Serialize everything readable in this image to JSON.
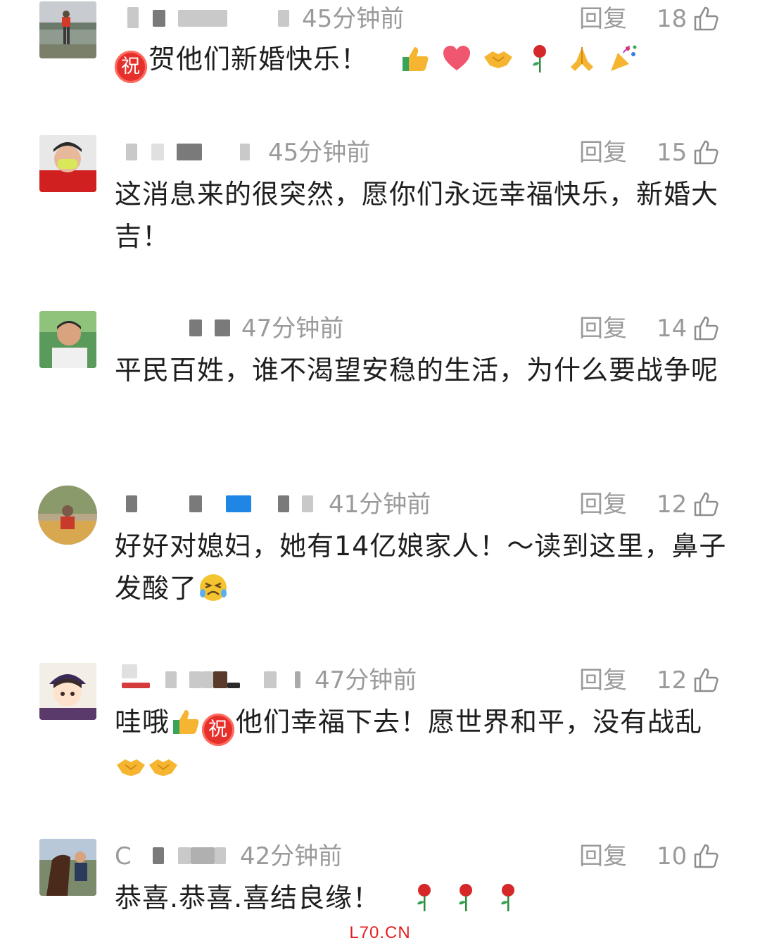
{
  "comments": [
    {
      "time": "45分钟前",
      "reply": "回复",
      "likes": "18",
      "text_before": "",
      "zhu_label": "祝",
      "text_after": "贺他们新婚快乐！",
      "emojis": [
        "thumbs-up",
        "heart",
        "handshake",
        "rose",
        "praying-hands",
        "party-popper"
      ]
    },
    {
      "time": "45分钟前",
      "reply": "回复",
      "likes": "15",
      "text": "这消息来的很突然，愿你们永远幸福快乐，新婚大吉！"
    },
    {
      "time": "47分钟前",
      "reply": "回复",
      "likes": "14",
      "text": "平民百姓，谁不渴望安稳的生活，为什么要战争呢"
    },
    {
      "time": "41分钟前",
      "reply": "回复",
      "likes": "12",
      "text": "好好对媳妇，她有14亿娘家人！～读到这里，鼻子发酸了",
      "emojis": [
        "crying-face"
      ]
    },
    {
      "time": "47分钟前",
      "reply": "回复",
      "likes": "12",
      "text_before": "哇哦",
      "zhu_label": "祝",
      "text_after": "他们幸福下去！愿世界和平，没有战乱",
      "emojis": [
        "handshake",
        "handshake"
      ]
    },
    {
      "name_initial": "C",
      "time": "42分钟前",
      "reply": "回复",
      "likes": "10",
      "text": "恭喜.恭喜.喜结良缘！",
      "emojis": [
        "rose",
        "rose",
        "rose"
      ]
    }
  ],
  "watermark": "L70.CN"
}
